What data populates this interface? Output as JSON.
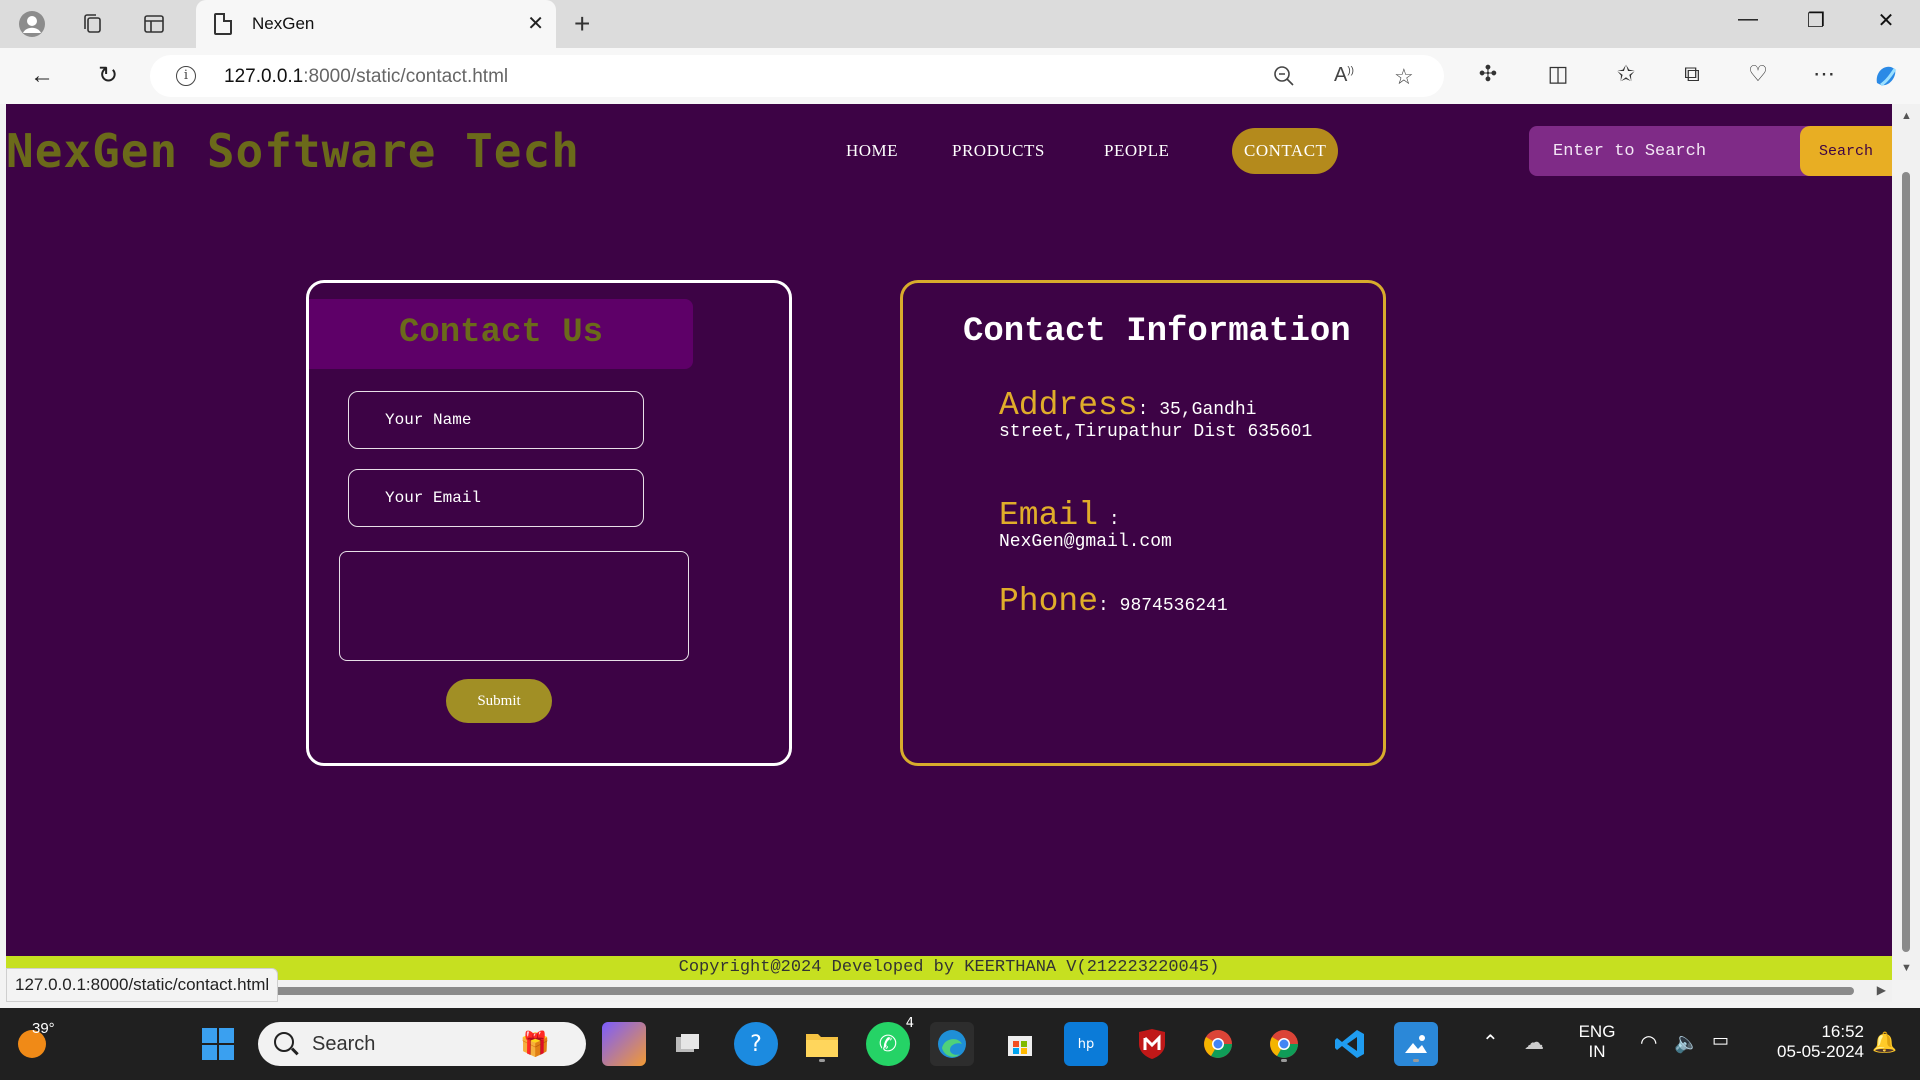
{
  "browser": {
    "tab_title": "NexGen",
    "url_host": "127.0.0.1",
    "url_rest": ":8000/static/contact.html",
    "status_url": "127.0.0.1:8000/static/contact.html"
  },
  "site": {
    "brand": "NexGen Software Tech",
    "nav": [
      "HOME",
      "PRODUCTS",
      "PEOPLE",
      "CONTACT"
    ],
    "active_nav": "CONTACT",
    "search_placeholder": "Enter to Search",
    "search_button": "Search"
  },
  "contact_form": {
    "title": "Contact Us",
    "name_placeholder": "Your Name",
    "email_placeholder": "Your Email",
    "message_value": "",
    "submit_label": "Submit"
  },
  "contact_info": {
    "title": "Contact Information",
    "address_label": "Address",
    "address_value": "35,Gandhi street,Tirupathur Dist 635601",
    "email_label": "Email",
    "email_value": "NexGen@gmail.com",
    "phone_label": "Phone",
    "phone_value": "9874536241"
  },
  "footer": {
    "text": "Copyright@2024 Developed by KEERTHANA V(212223220045)"
  },
  "taskbar": {
    "weather_temp": "39°",
    "search_placeholder": "Search",
    "whatsapp_badge": "4",
    "lang_line1": "ENG",
    "lang_line2": "IN",
    "time": "16:52",
    "date": "05-05-2024"
  },
  "colors": {
    "page_bg": "#3d0345",
    "brand_olive": "#6b6a1a",
    "accent_gold": "#e0ad2a",
    "footer_lime": "#c6e020"
  }
}
